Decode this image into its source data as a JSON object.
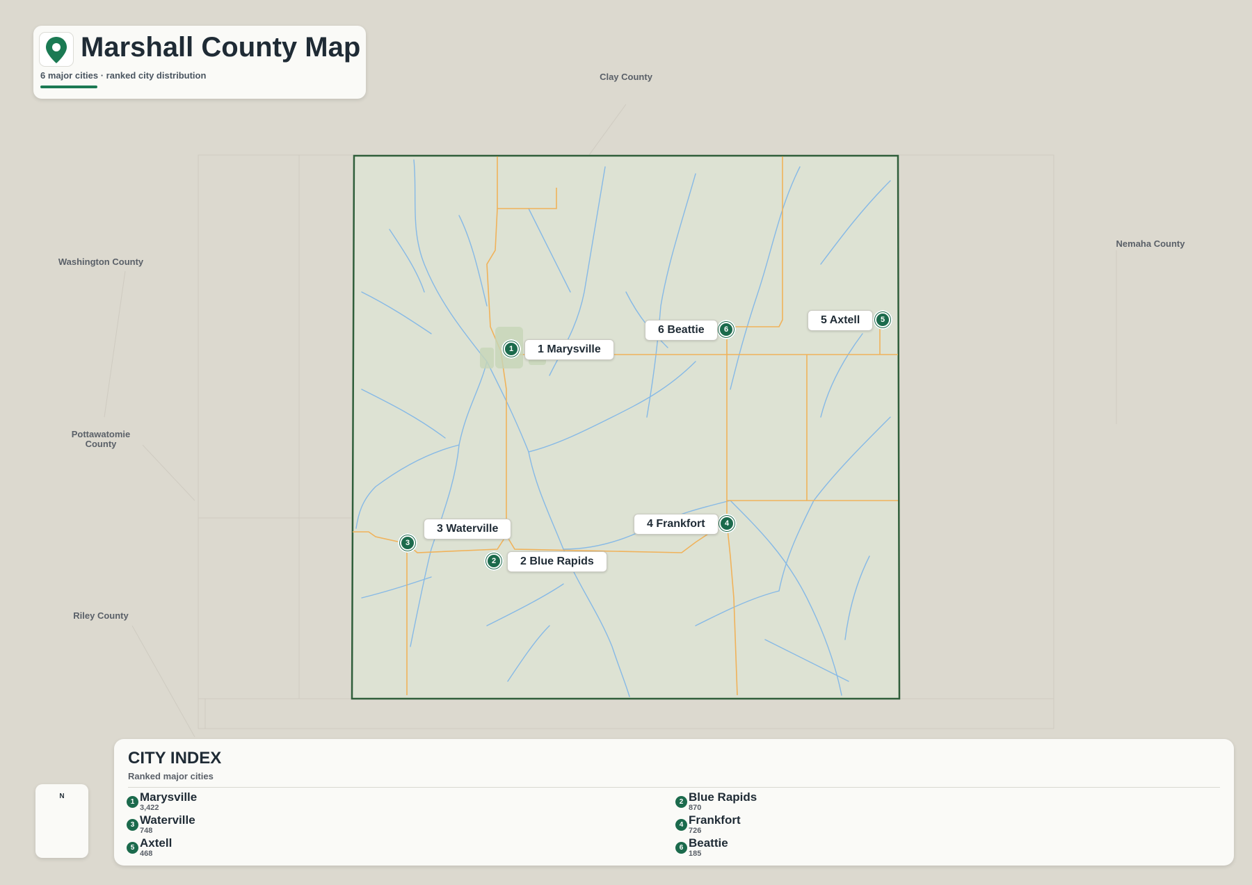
{
  "title": "Marshall County Map",
  "subtitle": "6 major cities · ranked city distribution",
  "neighbor_counties": {
    "clay": "Clay County",
    "nemaha": "Nemaha County",
    "washington": "Washington County",
    "pottawatomie_line1": "Pottawatomie",
    "pottawatomie_line2": "County",
    "riley": "Riley County"
  },
  "cities": [
    {
      "rank": "1",
      "name": "Marysville",
      "label": "1 Marysville",
      "population": "3,422"
    },
    {
      "rank": "2",
      "name": "Blue Rapids",
      "label": "2 Blue Rapids",
      "population": "870"
    },
    {
      "rank": "3",
      "name": "Waterville",
      "label": "3 Waterville",
      "population": "748"
    },
    {
      "rank": "4",
      "name": "Frankfort",
      "label": "4 Frankfort",
      "population": "726"
    },
    {
      "rank": "5",
      "name": "Axtell",
      "label": "5 Axtell",
      "population": "468"
    },
    {
      "rank": "6",
      "name": "Beattie",
      "label": "6 Beattie",
      "population": "185"
    }
  ],
  "index": {
    "title": "CITY INDEX",
    "subtitle": "Ranked major cities"
  },
  "compass": {
    "north": "N"
  },
  "colors": {
    "accent": "#1b7a53",
    "marker": "#1b6a4c",
    "county_border": "#2f5e3a",
    "roads": "#f0b25a",
    "rivers": "#7fb6e6"
  },
  "icons": {
    "title": "map-pin-icon",
    "compass": "compass-needle-icon"
  }
}
